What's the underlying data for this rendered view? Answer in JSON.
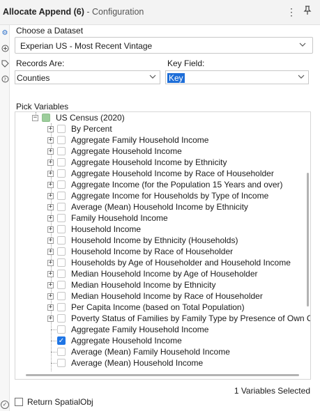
{
  "header": {
    "tool_name": "Allocate Append (6)",
    "section": " - Configuration",
    "menu_icon": "more-vertical-icon",
    "pin_icon": "pin-icon"
  },
  "sidebar": {
    "icons": [
      "gear-icon",
      "dataset-icon",
      "tag-icon",
      "help-icon",
      "status-check-icon"
    ]
  },
  "dataset": {
    "label": "Choose a Dataset",
    "value": "Experian US - Most Recent Vintage"
  },
  "records": {
    "label": "Records Are:",
    "value": "Counties"
  },
  "key_field": {
    "label": "Key Field:",
    "value": "Key"
  },
  "pick_variables": {
    "label": "Pick Variables",
    "rows": [
      {
        "text": "US Census (2020)",
        "level": 0,
        "expander": "minus",
        "state": "partial"
      },
      {
        "text": "By Percent",
        "level": 1,
        "expander": "plus",
        "state": "none"
      },
      {
        "text": "Aggregate Family Household Income",
        "level": 1,
        "expander": "plus",
        "state": "none"
      },
      {
        "text": "Aggregate Household Income",
        "level": 1,
        "expander": "plus",
        "state": "none"
      },
      {
        "text": "Aggregate Household Income by Ethnicity",
        "level": 1,
        "expander": "plus",
        "state": "none"
      },
      {
        "text": "Aggregate Household Income by Race of Householder",
        "level": 1,
        "expander": "plus",
        "state": "none"
      },
      {
        "text": "Aggregate Income (for the Population 15 Years and over)",
        "level": 1,
        "expander": "plus",
        "state": "none"
      },
      {
        "text": "Aggregate Income for Households by Type of Income",
        "level": 1,
        "expander": "plus",
        "state": "none"
      },
      {
        "text": "Average (Mean) Household Income by Ethnicity",
        "level": 1,
        "expander": "plus",
        "state": "none"
      },
      {
        "text": "Family Household Income",
        "level": 1,
        "expander": "plus",
        "state": "none"
      },
      {
        "text": "Household Income",
        "level": 1,
        "expander": "plus",
        "state": "none"
      },
      {
        "text": "Household Income by Ethnicity (Households)",
        "level": 1,
        "expander": "plus",
        "state": "none"
      },
      {
        "text": "Household Income by Race of Householder",
        "level": 1,
        "expander": "plus",
        "state": "none"
      },
      {
        "text": "Households by Age of Householder and Household Income",
        "level": 1,
        "expander": "plus",
        "state": "none"
      },
      {
        "text": "Median Household Income by Age of Householder",
        "level": 1,
        "expander": "plus",
        "state": "none"
      },
      {
        "text": "Median Household Income by Ethnicity",
        "level": 1,
        "expander": "plus",
        "state": "none"
      },
      {
        "text": "Median Household Income by Race of Householder",
        "level": 1,
        "expander": "plus",
        "state": "none"
      },
      {
        "text": "Per Capita Income (based on Total Population)",
        "level": 1,
        "expander": "plus",
        "state": "none"
      },
      {
        "text": "Poverty Status of Families by Family Type by Presence of Own Childre",
        "level": 1,
        "expander": "plus",
        "state": "none"
      },
      {
        "text": "Aggregate Family Household Income",
        "level": 1,
        "expander": "none",
        "state": "none"
      },
      {
        "text": "Aggregate Household Income",
        "level": 1,
        "expander": "none",
        "state": "checked"
      },
      {
        "text": "Average (Mean) Family Household Income",
        "level": 1,
        "expander": "none",
        "state": "none"
      },
      {
        "text": "Average (Mean) Household Income",
        "level": 1,
        "expander": "none",
        "state": "none"
      }
    ]
  },
  "summary": "1 Variables Selected",
  "return_spatial": {
    "label": "Return SpatialObj",
    "checked": false
  }
}
